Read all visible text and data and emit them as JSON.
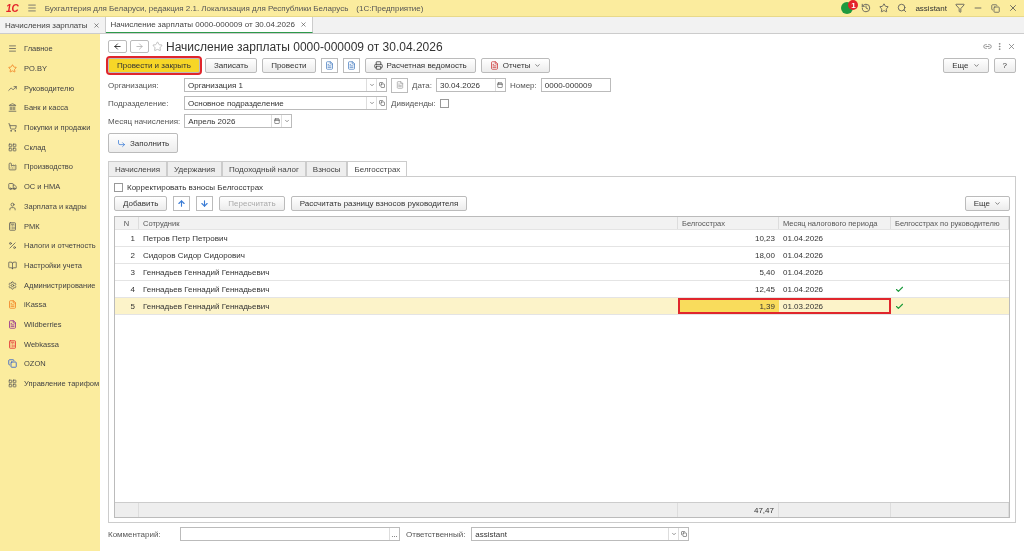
{
  "app_bar": {
    "logo": "1С",
    "title": "Бухгалтерия для Беларуси, редакция 2.1. Локализация для Республики Беларусь",
    "platform": "(1С:Предприятие)",
    "notifications": "1",
    "user": "assistant"
  },
  "open_tabs": [
    {
      "label": "Начисления зарплаты",
      "selected": false
    },
    {
      "label": "Начисление зарплаты 0000-000009 от 30.04.2026",
      "selected": true
    }
  ],
  "sidebar": {
    "items": [
      {
        "label": "Главное"
      },
      {
        "label": "PO.BY"
      },
      {
        "label": "Руководителю"
      },
      {
        "label": "Банк и касса"
      },
      {
        "label": "Покупки и продажи"
      },
      {
        "label": "Склад"
      },
      {
        "label": "Производство"
      },
      {
        "label": "ОС и НМА"
      },
      {
        "label": "Зарплата и кадры"
      },
      {
        "label": "РМК"
      },
      {
        "label": "Налоги и отчетность"
      },
      {
        "label": "Настройки учета"
      },
      {
        "label": "Администрирование"
      },
      {
        "label": "iKassa"
      },
      {
        "label": "Wildberries"
      },
      {
        "label": "Webkassa"
      },
      {
        "label": "OZON"
      },
      {
        "label": "Управление тарифом"
      }
    ]
  },
  "document": {
    "title": "Начисление зарплаты 0000-000009 от 30.04.2026",
    "commands": [
      {
        "kind": "default",
        "label": "Провести и закрыть",
        "marked": true
      },
      {
        "kind": "button",
        "label": "Записать",
        "marked": false
      },
      {
        "kind": "button",
        "label": "Провести",
        "marked": false
      },
      {
        "kind": "icon",
        "marked": false
      },
      {
        "kind": "icon",
        "marked": false
      },
      {
        "kind": "print",
        "label": "Расчетная ведомость",
        "marked": false
      },
      {
        "kind": "menu",
        "label": "Отчеты",
        "marked": false
      }
    ],
    "more": "Еще",
    "help": "?",
    "organization": {
      "label": "Организация:",
      "value": "Организация 1"
    },
    "date": {
      "label": "Дата:",
      "value": "30.04.2026"
    },
    "number": {
      "label": "Номер:",
      "value": "0000-000009"
    },
    "department": {
      "label": "Подразделение:",
      "value": "Основное подразделение"
    },
    "dividends": {
      "label": "Дивиденды:",
      "checked": false
    },
    "month": {
      "label": "Месяц начисления:",
      "value": "Апрель 2026"
    },
    "fill_button": "Заполнить",
    "tabs": [
      {
        "label": "Начисления",
        "selected": false
      },
      {
        "label": "Удержания",
        "selected": false
      },
      {
        "label": "Подоходный налог",
        "selected": false
      },
      {
        "label": "Взносы",
        "selected": false
      },
      {
        "label": "Белгосстрах",
        "selected": true
      }
    ],
    "correct": {
      "label": "Корректировать взносы Белгосстрах",
      "checked": false
    },
    "toolbar": [
      {
        "kind": "button",
        "label": "Добавить",
        "disabled": false
      },
      {
        "kind": "up",
        "disabled": false
      },
      {
        "kind": "down",
        "disabled": false
      },
      {
        "kind": "button",
        "label": "Пересчитать",
        "disabled": true
      },
      {
        "kind": "button",
        "label": "Рассчитать разницу взносов руководителя",
        "disabled": false
      }
    ],
    "toolbar_more": "Еще",
    "table": {
      "columns": [
        "N",
        "Сотрудник",
        "Белгосстрах",
        "Месяц налогового периода",
        "Белгосстрах по руководителю"
      ],
      "rows": [
        {
          "n": "1",
          "employee": "Петров Петр Петрович",
          "amount": "10,23",
          "month": "01.04.2026",
          "by_manager": false,
          "selected": false,
          "marked": false
        },
        {
          "n": "2",
          "employee": "Сидоров Сидор Сидорович",
          "amount": "18,00",
          "month": "01.04.2026",
          "by_manager": false,
          "selected": false,
          "marked": false
        },
        {
          "n": "3",
          "employee": "Геннадьев Геннадий Геннадьевич",
          "amount": "5,40",
          "month": "01.04.2026",
          "by_manager": false,
          "selected": false,
          "marked": false
        },
        {
          "n": "4",
          "employee": "Геннадьев Геннадий Геннадьевич",
          "amount": "12,45",
          "month": "01.04.2026",
          "by_manager": true,
          "selected": false,
          "marked": false
        },
        {
          "n": "5",
          "employee": "Геннадьев Геннадий Геннадьевич",
          "amount": "1,39",
          "month": "01.03.2026",
          "by_manager": true,
          "selected": true,
          "marked": true
        }
      ],
      "total": "47,47"
    },
    "comment": {
      "label": "Комментарий:",
      "select_button": "..."
    },
    "responsible": {
      "label": "Ответственный:",
      "value": "assistant"
    }
  }
}
